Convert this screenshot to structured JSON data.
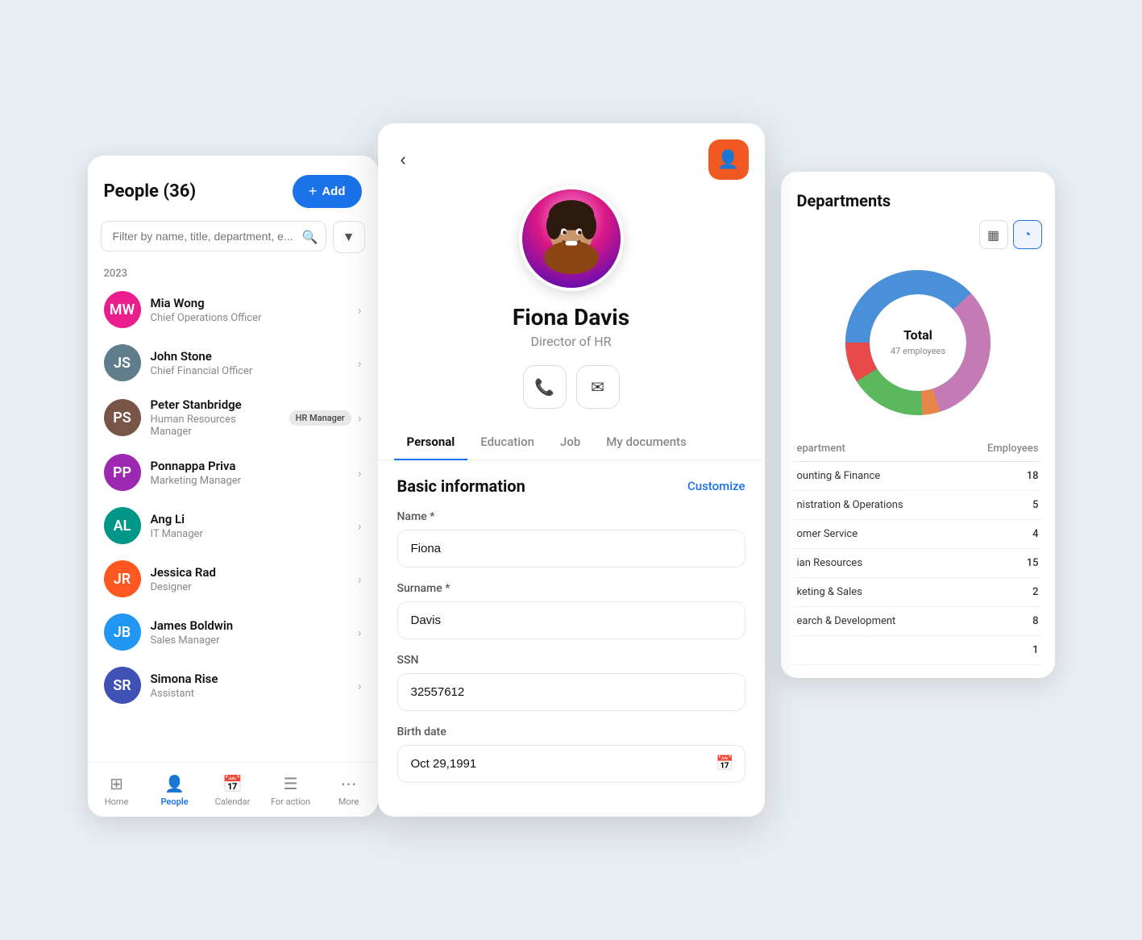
{
  "people_panel": {
    "title": "People (36)",
    "add_button": "Add",
    "search_placeholder": "Filter by name, title, department, e...",
    "year": "2023",
    "people": [
      {
        "name": "Mia Wong",
        "title": "Chief Operations Officer",
        "avatar_initials": "MW",
        "avatar_class": "av-pink",
        "badge": null
      },
      {
        "name": "John Stone",
        "title": "Chief Financial Officer",
        "avatar_initials": "JS",
        "avatar_class": "av-gray",
        "badge": null
      },
      {
        "name": "Peter Stanbridge",
        "title": "Human Resources Manager",
        "avatar_initials": "PS",
        "avatar_class": "av-brown",
        "badge": "HR Manager"
      },
      {
        "name": "Ponnappa Priva",
        "title": "Marketing Manager",
        "avatar_initials": "PP",
        "avatar_class": "av-purple",
        "badge": null
      },
      {
        "name": "Ang Li",
        "title": "IT Manager",
        "avatar_initials": "AL",
        "avatar_class": "av-teal",
        "badge": null
      },
      {
        "name": "Jessica Rad",
        "title": "Designer",
        "avatar_initials": "JR",
        "avatar_class": "av-orange",
        "badge": null
      },
      {
        "name": "James Boldwin",
        "title": "Sales Manager",
        "avatar_initials": "JB",
        "avatar_class": "av-blue",
        "badge": null
      },
      {
        "name": "Simona Rise",
        "title": "Assistant",
        "avatar_initials": "SR",
        "avatar_class": "av-darkblue",
        "badge": null
      }
    ],
    "nav": [
      {
        "label": "Home",
        "icon": "⊞",
        "active": false
      },
      {
        "label": "People",
        "icon": "👤",
        "active": true
      },
      {
        "label": "Calendar",
        "icon": "📅",
        "active": false
      },
      {
        "label": "For action",
        "icon": "☰",
        "active": false
      },
      {
        "label": "More",
        "icon": "···",
        "active": false
      }
    ]
  },
  "profile_panel": {
    "name": "Fiona Davis",
    "subtitle": "Director of HR",
    "tabs": [
      "Personal",
      "Education",
      "Job",
      "My documents"
    ],
    "active_tab": "Personal",
    "section_title": "Basic information",
    "customize_label": "Customize",
    "fields": [
      {
        "label": "Name *",
        "value": "Fiona",
        "type": "text"
      },
      {
        "label": "Surname *",
        "value": "Davis",
        "type": "text"
      },
      {
        "label": "SSN",
        "value": "32557612",
        "type": "text"
      },
      {
        "label": "Birth date",
        "value": "Oct 29,1991",
        "type": "date"
      }
    ]
  },
  "departments_panel": {
    "title": "Departments",
    "chart": {
      "total_label": "Total",
      "total_count": "47 employees",
      "segments": [
        {
          "label": "Accounting & Finance",
          "color": "#4a90d9",
          "value": 18,
          "percent": 38
        },
        {
          "label": "Human Resources",
          "color": "#c47bb5",
          "value": 15,
          "percent": 32
        },
        {
          "label": "Marketing & Sales",
          "color": "#e8854a",
          "value": 2,
          "percent": 4
        },
        {
          "label": "Research & Development",
          "color": "#5cb85c",
          "value": 8,
          "percent": 17
        },
        {
          "label": "Customer Service",
          "color": "#e84a4a",
          "value": 4,
          "percent": 9
        }
      ]
    },
    "table": {
      "col1": "epartment",
      "col2": "Employees",
      "rows": [
        {
          "name": "ounting & Finance",
          "count": "18"
        },
        {
          "name": "nistration & Operations",
          "count": "5"
        },
        {
          "name": "omer Service",
          "count": "4"
        },
        {
          "name": "ian Resources",
          "count": "15"
        },
        {
          "name": "keting & Sales",
          "count": "2"
        },
        {
          "name": "earch & Development",
          "count": "8"
        },
        {
          "name": "",
          "count": "1"
        }
      ]
    }
  }
}
